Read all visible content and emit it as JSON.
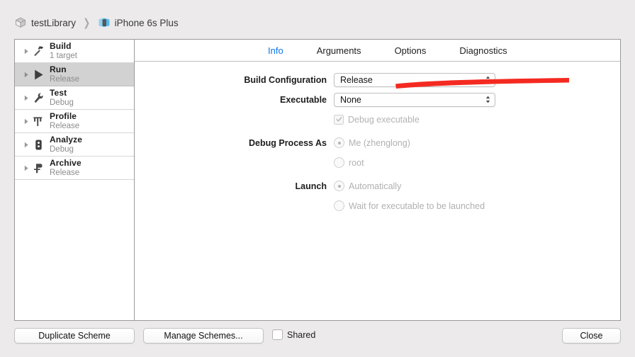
{
  "breadcrumb": {
    "project": {
      "label": "testLibrary",
      "icon": "framework-icon"
    },
    "separator": "❯",
    "destination": {
      "label": "iPhone 6s Plus",
      "icon": "simulator-icon"
    }
  },
  "sidebar": {
    "items": [
      {
        "title": "Build",
        "subtitle": "1 target",
        "icon": "hammer-icon",
        "selected": false
      },
      {
        "title": "Run",
        "subtitle": "Release",
        "icon": "play-icon",
        "selected": true
      },
      {
        "title": "Test",
        "subtitle": "Debug",
        "icon": "wrench-icon",
        "selected": false
      },
      {
        "title": "Profile",
        "subtitle": "Release",
        "icon": "gauge-icon",
        "selected": false
      },
      {
        "title": "Analyze",
        "subtitle": "Debug",
        "icon": "analyze-icon",
        "selected": false
      },
      {
        "title": "Archive",
        "subtitle": "Release",
        "icon": "archive-icon",
        "selected": false
      }
    ]
  },
  "tabs": [
    {
      "label": "Info",
      "active": true
    },
    {
      "label": "Arguments",
      "active": false
    },
    {
      "label": "Options",
      "active": false
    },
    {
      "label": "Diagnostics",
      "active": false
    }
  ],
  "form": {
    "build_configuration": {
      "label": "Build Configuration",
      "value": "Release"
    },
    "executable": {
      "label": "Executable",
      "value": "None"
    },
    "debug_executable": {
      "label": "Debug executable",
      "checked": true,
      "enabled": false
    },
    "debug_process_as": {
      "label": "Debug Process As",
      "options": [
        {
          "label": "Me (zhenglong)",
          "selected": true
        },
        {
          "label": "root",
          "selected": false
        }
      ]
    },
    "launch": {
      "label": "Launch",
      "options": [
        {
          "label": "Automatically",
          "selected": true
        },
        {
          "label": "Wait for executable to be launched",
          "selected": false
        }
      ]
    }
  },
  "annotation": {
    "type": "red-underline",
    "color": "#f42a21",
    "target": "build-configuration-select"
  },
  "bottom_bar": {
    "duplicate_scheme": "Duplicate Scheme",
    "manage_schemes": "Manage Schemes...",
    "shared": {
      "label": "Shared",
      "checked": false
    },
    "close": "Close"
  },
  "colors": {
    "accent_blue": "#0b74e8",
    "annotation_red": "#f42a21",
    "selected_row": "#d2d2d2",
    "window_bg": "#eceaea"
  }
}
